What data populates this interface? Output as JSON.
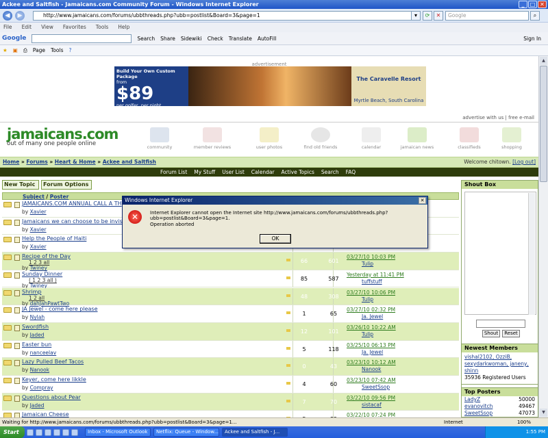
{
  "window": {
    "title": "Ackee and Saltfish - Jamaicans.com Community Forum - Windows Internet Explorer"
  },
  "address": {
    "url": "http://www.jamaicans.com/forums/ubbthreads.php?ubb=postlist&Board=3&page=1",
    "search_placeholder": "Google"
  },
  "menu": [
    "File",
    "Edit",
    "View",
    "Favorites",
    "Tools",
    "Help"
  ],
  "gtoolbar": {
    "brand": "Google",
    "items": [
      "Search",
      "Share",
      "Sidewiki",
      "Check",
      "Translate",
      "AutoFill"
    ],
    "signin": "Sign In"
  },
  "cmdbar": {
    "page": "Page",
    "tools": "Tools"
  },
  "ad": {
    "label": "advertisement",
    "headline": "Build Your Own Custom Package",
    "from": "from",
    "price": "$89",
    "pergolfer": "per golfer, per night",
    "brand": "The Caravelle Resort",
    "location": "Myrtle Beach, South Carolina"
  },
  "site": {
    "toplinks": [
      "advertise with us",
      "free e-mail"
    ],
    "logo": "jamaicans.com",
    "tagline": "out of many one people online",
    "navicons": [
      "community",
      "member reviews",
      "user photos",
      "find old friends",
      "calendar",
      "jamaican news",
      "classifieds",
      "shopping"
    ]
  },
  "crumbs": [
    "Home",
    "Forums",
    "Heart & Home",
    "Ackee and Saltfish"
  ],
  "welcome": {
    "text": "Welcome chitown.",
    "logout": "[Log out]"
  },
  "forumnav": [
    "Forum List",
    "My Stuff",
    "User List",
    "Calendar",
    "Active Topics",
    "Search",
    "FAQ"
  ],
  "buttons": {
    "new_topic": "New Topic",
    "forum_options": "Forum Options"
  },
  "table": {
    "subject_header": "Subject",
    "poster_header": "Poster"
  },
  "rows": [
    {
      "subject": "JAMAICANS.COM ANNUAL CALL A TH",
      "pages": "",
      "by": "Xavier",
      "replies": "",
      "views": "",
      "last": "",
      "lastby": ""
    },
    {
      "subject": "Jamaicans we can choose to be invisible",
      "pages": "",
      "by": "Xavier",
      "replies": "",
      "views": "",
      "last": "",
      "lastby": ""
    },
    {
      "subject": "Help the People of Haiti",
      "pages": "",
      "by": "Xavier",
      "replies": "",
      "views": "",
      "last": "",
      "lastby": ""
    },
    {
      "subject": "Recipe of the Day",
      "pages": "1 2 3 all",
      "by": "Twiney",
      "replies": "66",
      "views": "601",
      "last": "03/27/10 10:03 PM",
      "lastby": "Tulip"
    },
    {
      "subject": "Sunday Dinner",
      "pages": "( 1 2 3 all )",
      "by": "Twiney",
      "replies": "85",
      "views": "587",
      "last": "Yesterday at 11:41 PM",
      "lastby": "tuffstuff"
    },
    {
      "subject": "Shrimp",
      "pages": "1 2 all",
      "by": "dahJahPawtTwo",
      "replies": "48",
      "views": "308",
      "last": "03/27/10 10:06 PM",
      "lastby": "Tulip"
    },
    {
      "subject": "JA Jewel - come here please",
      "pages": "",
      "by": "Nylah",
      "replies": "1",
      "views": "65",
      "last": "03/27/10 02:32 PM",
      "lastby": "Ja. Jewel"
    },
    {
      "subject": "Swordfish",
      "pages": "",
      "by": "Jaded",
      "replies": "12",
      "views": "101",
      "last": "03/26/10 10:22 AM",
      "lastby": "Tulip"
    },
    {
      "subject": "Easter bun",
      "pages": "",
      "by": "nanceelav",
      "replies": "5",
      "views": "118",
      "last": "03/25/10 06:13 PM",
      "lastby": "Ja. Jewel"
    },
    {
      "subject": "Lazy Pulled Beef Tacos",
      "pages": "",
      "by": "Nanook",
      "replies": "0",
      "views": "43",
      "last": "03/23/10 10:12 AM",
      "lastby": "Nanook"
    },
    {
      "subject": "Keyer, come here likkle",
      "pages": "",
      "by": "Compray",
      "replies": "4",
      "views": "60",
      "last": "03/23/10 07:42 AM",
      "lastby": "SweetSsop"
    },
    {
      "subject": "Questions about Pear",
      "pages": "",
      "by": "Jaded",
      "replies": "7",
      "views": "70",
      "last": "03/22/10 09:56 PM",
      "lastby": "sistacaf"
    },
    {
      "subject": "Jamaican Cheese",
      "pages": "",
      "by": "",
      "replies": "5",
      "views": "82",
      "last": "03/22/10 07:24 PM",
      "lastby": ""
    }
  ],
  "shoutbox": {
    "title": "Shout Box",
    "shout": "Shout",
    "reset": "Reset"
  },
  "newmembers": {
    "title": "Newest Members",
    "names": "vishal2102, OzziB, sexydarkwoman, janeny, shinn",
    "count": "35936 Registered Users"
  },
  "topposters": {
    "title": "Top Posters",
    "list": [
      {
        "name": "LadyZ",
        "count": "50000"
      },
      {
        "name": "evanovitch",
        "count": "49467"
      },
      {
        "name": "SweetSsop",
        "count": "47073"
      }
    ]
  },
  "dialog": {
    "title": "Windows Internet Explorer",
    "message": "Internet Explorer cannot open the Internet site http://www.jamaicans.com/forums/ubbthreads.php?ubb=postlist&Board=3&page=1.",
    "detail": "Operation aborted",
    "ok": "OK"
  },
  "statusbar": {
    "text": "Waiting for http://www.jamaicans.com/forums/ubbthreads.php?ubb=postlist&Board=3&page=1...",
    "zone": "Internet",
    "zoom": "100%"
  },
  "taskbar": {
    "start": "Start",
    "tasks": [
      "Inbox - Microsoft Outlook",
      "Netflix: Queue - Window...",
      "Ackee and Saltfish - J..."
    ],
    "time": "1:55 PM"
  }
}
